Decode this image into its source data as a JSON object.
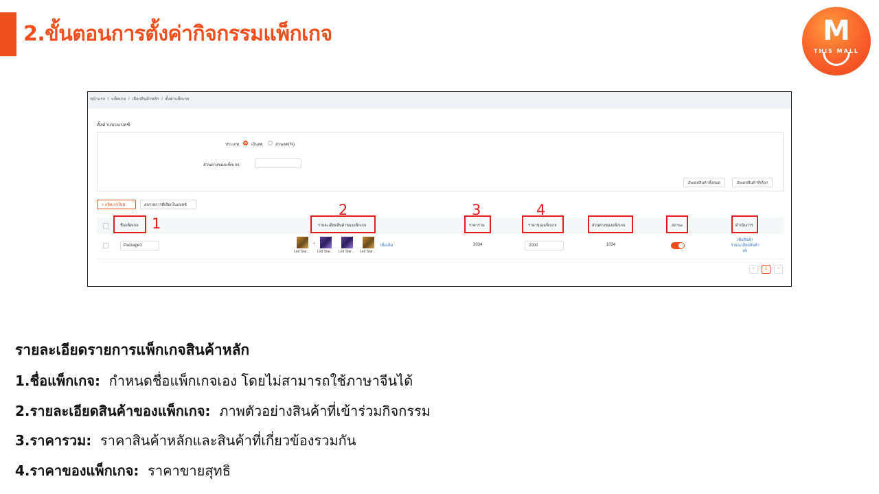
{
  "slide": {
    "title": "2.ขั้นตอนการตั้งค่ากิจกรรมแพ็กเกจ",
    "logo_letter": "M",
    "logo_text": "THIS MALL",
    "accent_color": "#f04e1c"
  },
  "screenshot": {
    "breadcrumb": [
      "หน้าแรก",
      "/",
      "แพ็คเกจ",
      "/",
      "เลือกสินค้าหลัก",
      "/",
      "ตั้งค่าแพ็กเกจ"
    ],
    "section_title": "ตั้งค่าแบบแบทช์",
    "type_label": "ประเภท:",
    "type_options": [
      "เงินสด",
      "ส่วนลด(%)"
    ],
    "diff_label": "ส่วนต่างของแพ็กเกจ:",
    "btn_update_all": "อัพเดทสินค้าทั้งหมด",
    "btn_update_selected": "อัพเดทสินค้าที่เลือก",
    "btn_add_package": "+ แพ็คเกจใหม่",
    "btn_delete_selected": "ลบรายการที่เลือกในแบทช์",
    "columns": [
      "ชื่อแพ็คเกจ",
      "รายละเอียดสินค้าของแพ็กเกจ",
      "ราคารวม",
      "ราคาของแพ็กเกจ",
      "ส่วนต่างของแพ็กเกจ",
      "สถานะ",
      "ดำเนินการ"
    ],
    "row": {
      "name": "Package1",
      "products": [
        "Led Star...",
        "Led Star...",
        "Led Star...",
        "Led Star..."
      ],
      "plus": "+",
      "more": "เพิ่มเติม",
      "total_price": "3034",
      "package_price": "2000",
      "difference": "1034",
      "actions": [
        "เพิ่มสินค้า",
        "รายละเอียดสินค้า",
        "ลบ"
      ]
    },
    "pager": {
      "prev": "<",
      "current": "1",
      "next": ">"
    }
  },
  "annotations": [
    "1",
    "2",
    "3",
    "4"
  ],
  "details": {
    "heading": "รายละเอียดรายการแพ็กเกจสินค้าหลัก",
    "items": [
      {
        "label": "1.ชื่อแพ็กเกจ:",
        "text": "กำหนดชื่อแพ็กเกจเอง โดยไม่สามารถใช้ภาษาจีนได้"
      },
      {
        "label": "2.รายละเอียดสินค้าของแพ็กเกจ:",
        "text": "ภาพตัวอย่างสินค้าที่เข้าร่วมกิจกรรม"
      },
      {
        "label": "3.ราคารวม:",
        "text": "ราคาสินค้าหลักและสินค้าที่เกี่ยวข้องรวมกัน"
      },
      {
        "label": "4.ราคาของแพ็กเกจ:",
        "text": "ราคาขายสุทธิ"
      }
    ]
  }
}
